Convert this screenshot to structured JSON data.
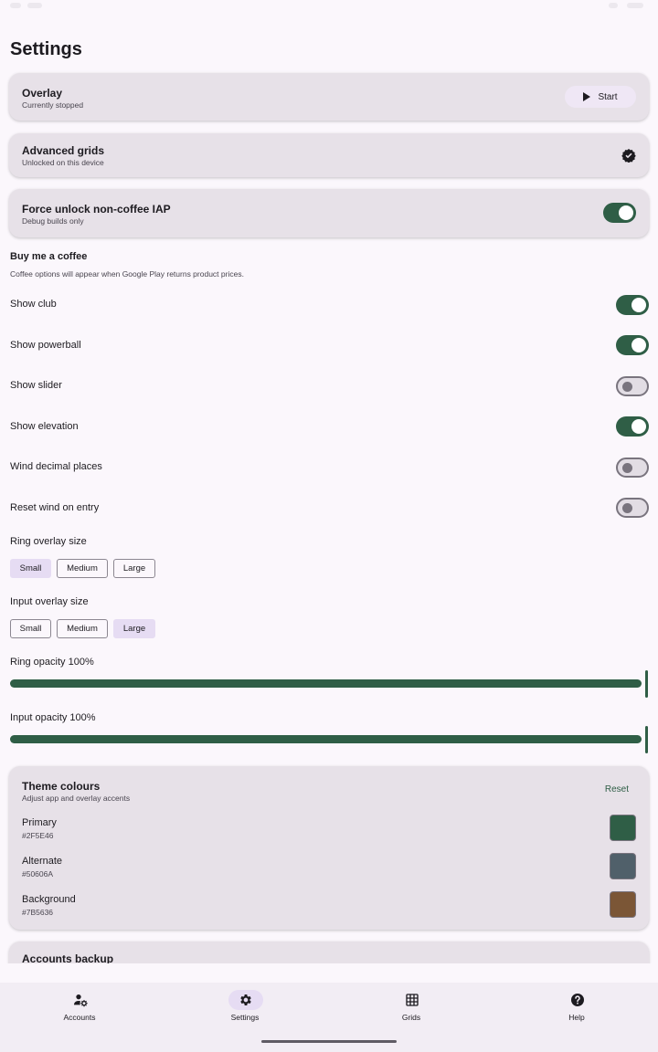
{
  "page": {
    "title": "Settings"
  },
  "overlay_card": {
    "title": "Overlay",
    "subtitle": "Currently stopped",
    "start_label": "Start"
  },
  "grids_card": {
    "title": "Advanced grids",
    "subtitle": "Unlocked on this device",
    "icon": "verified-badge-icon"
  },
  "iap_card": {
    "title": "Force unlock non-coffee IAP",
    "subtitle": "Debug builds only",
    "toggle_on": true
  },
  "coffee": {
    "title": "Buy me a coffee",
    "note": "Coffee options will appear when Google Play returns product prices."
  },
  "toggles": [
    {
      "label": "Show club",
      "on": true
    },
    {
      "label": "Show powerball",
      "on": true
    },
    {
      "label": "Show slider",
      "on": false
    },
    {
      "label": "Show elevation",
      "on": true
    },
    {
      "label": "Wind decimal places",
      "on": false
    },
    {
      "label": "Reset wind on entry",
      "on": false
    }
  ],
  "ring_size": {
    "label": "Ring overlay size",
    "options": [
      "Small",
      "Medium",
      "Large"
    ],
    "selected": "Small"
  },
  "input_size": {
    "label": "Input overlay size",
    "options": [
      "Small",
      "Medium",
      "Large"
    ],
    "selected": "Large"
  },
  "ring_opacity": {
    "label": "Ring opacity 100%",
    "value": 1.0
  },
  "input_opacity": {
    "label": "Input opacity 100%",
    "value": 1.0
  },
  "theme": {
    "title": "Theme colours",
    "subtitle": "Adjust app and overlay accents",
    "reset_label": "Reset",
    "colours": [
      {
        "name": "Primary",
        "hex": "#2F5E46"
      },
      {
        "name": "Alternate",
        "hex": "#50606A"
      },
      {
        "name": "Background",
        "hex": "#7B5636"
      }
    ]
  },
  "backup_card": {
    "title": "Accounts backup"
  },
  "nav": {
    "items": [
      {
        "label": "Accounts",
        "icon": "accounts-icon"
      },
      {
        "label": "Settings",
        "icon": "gear-icon"
      },
      {
        "label": "Grids",
        "icon": "grid-icon"
      },
      {
        "label": "Help",
        "icon": "help-icon"
      }
    ],
    "active": "Settings"
  },
  "colors": {
    "primary": "#2F5E46",
    "surface": "#FBF7FC",
    "card": "#E7E1E8",
    "selected": "#E6DCF3"
  }
}
